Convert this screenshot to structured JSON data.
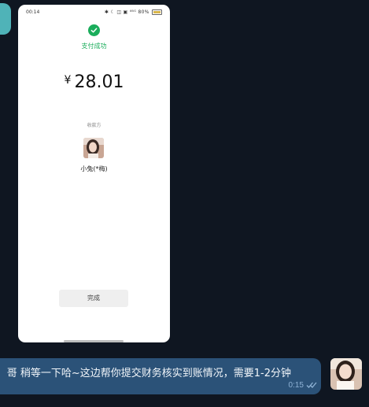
{
  "colors": {
    "background": "#0f1621",
    "bubble": "#2b5278",
    "wechat_green": "#1aad5b",
    "accent_teal": "#4fb3b8"
  },
  "screenshot": {
    "status_time": "00:14",
    "status_icons": "✱ ☾ ◫ ▣ ⁴⁶ᴳ 80%",
    "battery_level": 0.8,
    "success_icon": "check-circle-icon",
    "success_text": "支付成功",
    "currency_symbol": "¥",
    "amount": "28.01",
    "payee_label": "收款方",
    "payee_name": "小兔(*梅)",
    "done_label": "完成"
  },
  "message": {
    "text": "哥   稍等一下哈~这边帮你提交财务核实到账情况，需要1-2分钟",
    "time": "0:15",
    "status_icon": "double-check-icon"
  }
}
